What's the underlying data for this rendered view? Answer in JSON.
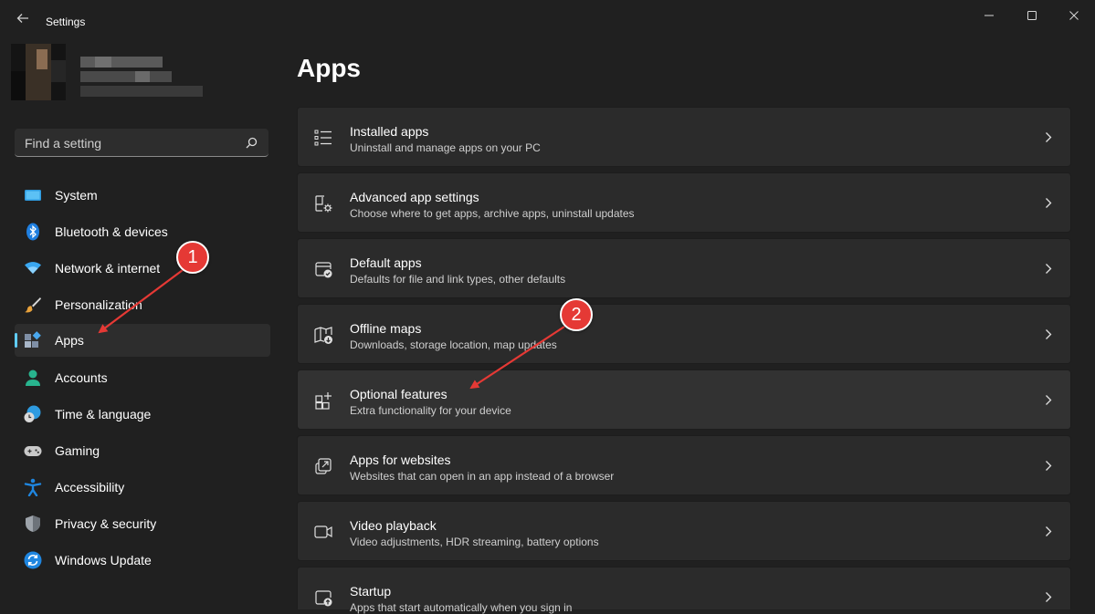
{
  "window": {
    "title": "Settings"
  },
  "search": {
    "placeholder": "Find a setting"
  },
  "nav": {
    "selected": "Apps",
    "items": [
      {
        "label": "System",
        "icon": "system-icon"
      },
      {
        "label": "Bluetooth & devices",
        "icon": "bluetooth-icon"
      },
      {
        "label": "Network & internet",
        "icon": "network-icon"
      },
      {
        "label": "Personalization",
        "icon": "brush-icon"
      },
      {
        "label": "Apps",
        "icon": "apps-icon"
      },
      {
        "label": "Accounts",
        "icon": "accounts-icon"
      },
      {
        "label": "Time & language",
        "icon": "time-language-icon"
      },
      {
        "label": "Gaming",
        "icon": "gaming-icon"
      },
      {
        "label": "Accessibility",
        "icon": "accessibility-icon"
      },
      {
        "label": "Privacy & security",
        "icon": "shield-icon"
      },
      {
        "label": "Windows Update",
        "icon": "update-icon"
      }
    ]
  },
  "main": {
    "title": "Apps",
    "cards": [
      {
        "title": "Installed apps",
        "subtitle": "Uninstall and manage apps on your PC",
        "icon": "list-icon"
      },
      {
        "title": "Advanced app settings",
        "subtitle": "Choose where to get apps, archive apps, uninstall updates",
        "icon": "app-settings-icon"
      },
      {
        "title": "Default apps",
        "subtitle": "Defaults for file and link types, other defaults",
        "icon": "default-apps-icon"
      },
      {
        "title": "Offline maps",
        "subtitle": "Downloads, storage location, map updates",
        "icon": "map-icon"
      },
      {
        "title": "Optional features",
        "subtitle": "Extra functionality for your device",
        "icon": "optional-features-icon"
      },
      {
        "title": "Apps for websites",
        "subtitle": "Websites that can open in an app instead of a browser",
        "icon": "open-external-icon"
      },
      {
        "title": "Video playback",
        "subtitle": "Video adjustments, HDR streaming, battery options",
        "icon": "video-icon"
      },
      {
        "title": "Startup",
        "subtitle": "Apps that start automatically when you sign in",
        "icon": "startup-icon"
      }
    ]
  },
  "annotations": {
    "badge1": "1",
    "badge2": "2"
  },
  "colors": {
    "accent": "#60cdff",
    "annotation": "#e53935",
    "background": "#202020",
    "card": "#2b2b2b"
  }
}
